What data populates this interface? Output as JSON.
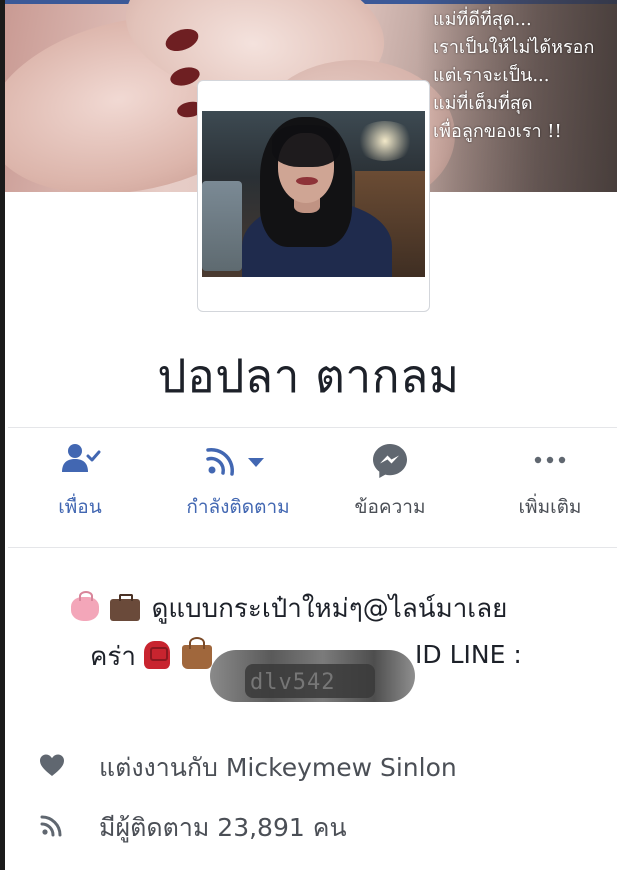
{
  "cover": {
    "caption_lines": [
      "แม่ที่ดีที่สุด...",
      "เราเป็นให้ไม่ได้หรอก",
      "แต่เราจะเป็น...",
      "แม่ที่เต็มที่สุด",
      "เพื่อลูกของเรา !!"
    ]
  },
  "profile": {
    "name": "ปอปลา ตากลม"
  },
  "actions": [
    {
      "label": "เพื่อน",
      "icon": "friends-check-icon"
    },
    {
      "label": "กำลังติดตาม",
      "icon": "rss-follow-dropdown-icon"
    },
    {
      "label": "ข้อความ",
      "icon": "messenger-icon"
    },
    {
      "label": "เพิ่มเติม",
      "icon": "more-dots-icon"
    }
  ],
  "bio": {
    "line1": "ดูแบบกระเป๋าใหม่ๆ@ไลน์มาเลย",
    "line2": "คร่า",
    "id_line": "ID LINE :",
    "redacted_id": "dlv542"
  },
  "info": {
    "married": "แต่งงานกับ Mickeymew Sinlon",
    "followers": "มีผู้ติดตาม 23,891 คน"
  },
  "colors": {
    "facebook_blue": "#4267b2",
    "text_primary": "#1d2129",
    "text_secondary": "#4b4f56",
    "icon_gray": "#606770"
  }
}
